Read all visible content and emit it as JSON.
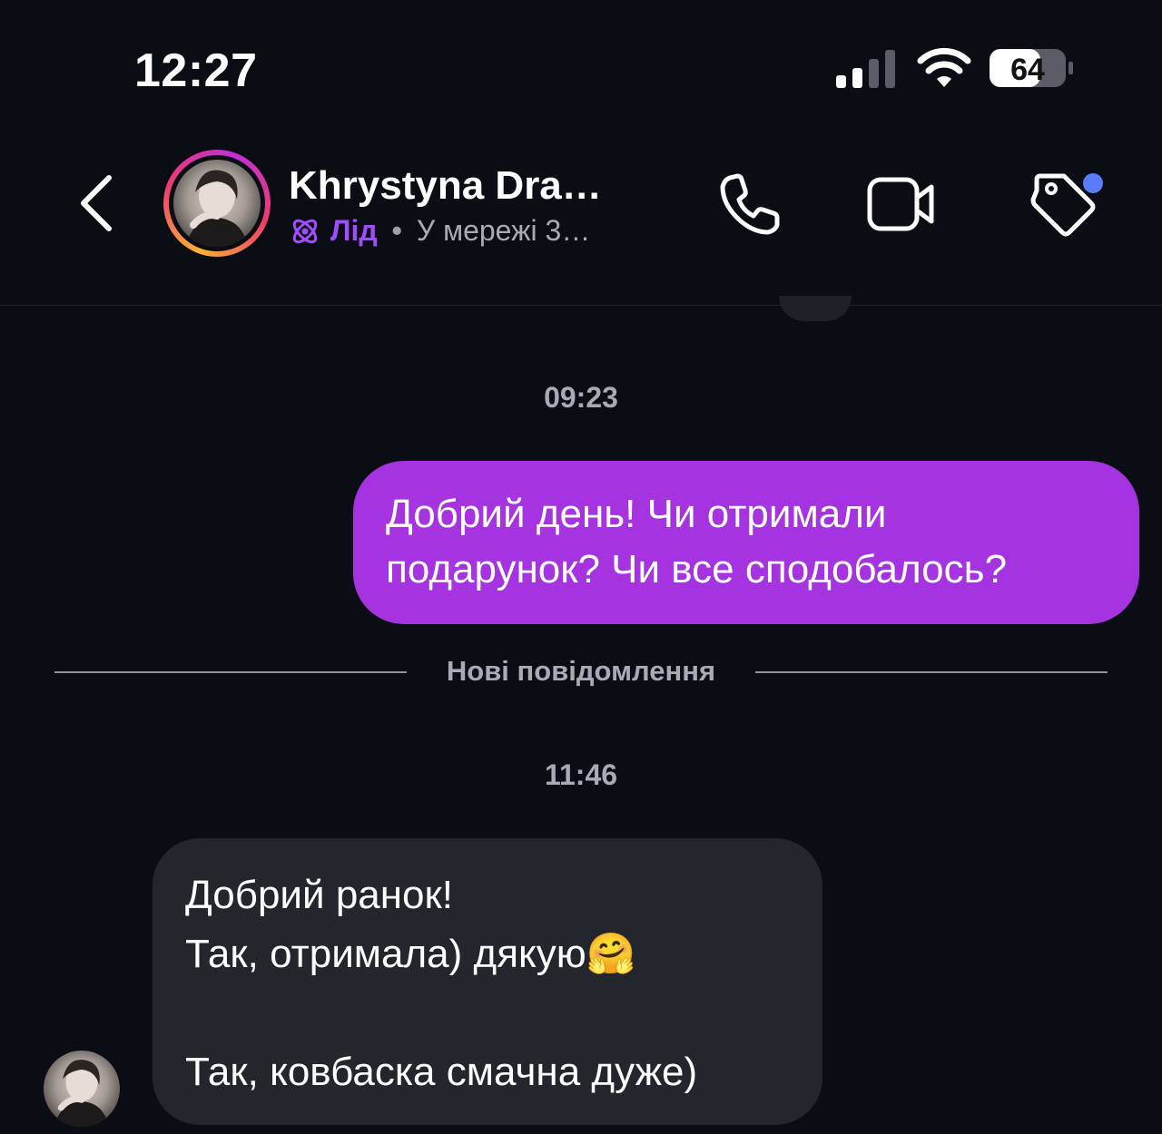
{
  "status_bar": {
    "time": "12:27",
    "battery": "64",
    "signal_icon": "cellular-signal-icon",
    "wifi_icon": "wifi-icon",
    "battery_icon": "battery-icon"
  },
  "header": {
    "contact_name": "Khrystyna Dra…",
    "lead_label": "Лід",
    "separator": "•",
    "online_status": "У мережі 3…",
    "icons": {
      "back": "chevron-left-icon",
      "lead": "atom-icon",
      "call": "phone-icon",
      "video": "video-camera-icon",
      "tag": "tag-icon"
    },
    "colors": {
      "lead": "#a14cff",
      "tag_badge": "#5b7cfa"
    }
  },
  "chat": {
    "messages": [
      {
        "timestamp": "09:23",
        "direction": "outgoing",
        "text": "Добрий день! Чи отримали\nподарунок? Чи все сподобалось?"
      },
      {
        "timestamp": "11:46",
        "direction": "incoming",
        "text": "Добрий ранок!\nТак, отримала) дякую🤗\n\nТак, ковбаска смачна дуже)"
      }
    ],
    "new_messages_label": "Нові повідомлення",
    "colors": {
      "outgoing_bubble": "#a633e0",
      "incoming_bubble": "#24262d"
    }
  }
}
